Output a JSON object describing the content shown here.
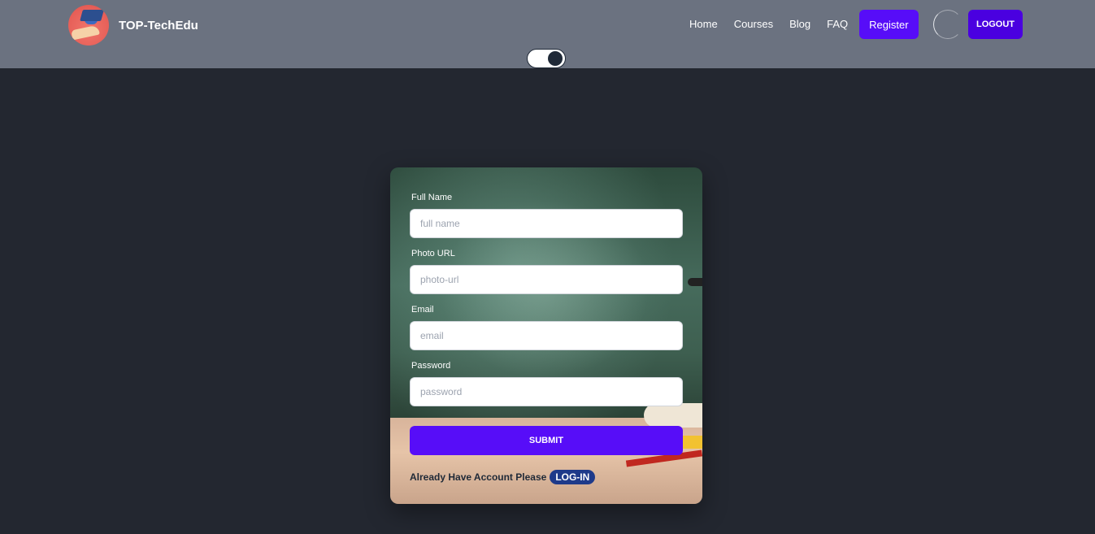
{
  "brand": {
    "name": "TOP-TechEdu",
    "logo_icon": "graduation-cap-hand-icon"
  },
  "nav": {
    "links": [
      "Home",
      "Courses",
      "Blog",
      "FAQ"
    ],
    "register_label": "Register",
    "logout_label": "LOGOUT"
  },
  "theme_toggle": {
    "state": "dark"
  },
  "form": {
    "full_name": {
      "label": "Full Name",
      "placeholder": "full name"
    },
    "photo_url": {
      "label": "Photo URL",
      "placeholder": "photo-url"
    },
    "email": {
      "label": "Email",
      "placeholder": "email"
    },
    "password": {
      "label": "Password",
      "placeholder": "password"
    },
    "submit_label": "SUBMIT",
    "login_prompt": "Already Have Account Please",
    "login_link": "LOG-IN"
  },
  "colors": {
    "navbar": "#6b7280",
    "page_bg": "#232730",
    "primary": "#570df8",
    "logout": "#4a00e0",
    "login_badge": "#1e3a8a"
  }
}
